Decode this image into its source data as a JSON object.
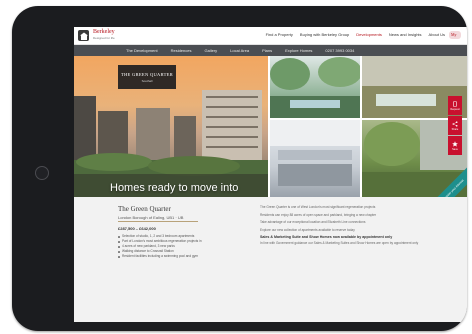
{
  "header": {
    "logo_text": "Berkeley",
    "logo_sub": "Designed for life",
    "links": [
      "Find a Property",
      "Buying with Berkeley Group",
      "Developments",
      "News and Insights",
      "About Us"
    ],
    "active_link": "Developments",
    "my_account_label": "My"
  },
  "nav": {
    "items": [
      "The Development",
      "Residences",
      "Gallery",
      "Local Area",
      "Plans",
      "Explore Homes",
      "0207 3993 0034"
    ]
  },
  "hero": {
    "title_box": {
      "title": "THE GREEN QUARTER",
      "subtitle": "Southall"
    },
    "headline": "Homes ready to move into",
    "side_tabs": [
      "Request",
      "Share",
      "Save"
    ],
    "ribbon_text": "Register your interest"
  },
  "development": {
    "title": "The Green Quarter",
    "location": "London Borough of Ealing, UB1 · UB",
    "price": "£287,500 – £642,000",
    "bullets": [
      "Selection of studio, 1, 2 and 3 bedroom apartments",
      "Part of London's most ambitious regeneration projects in",
      "4 acres of new parkland, 3 new parks",
      "Walking distance to Crossrail Station",
      "Resident facilities including a swimming pool and gym"
    ]
  },
  "right_column": {
    "paragraphs": [
      "The Green Quarter is one of West London's most significant regeneration projects",
      "Residents can enjoy 88 acres of open space and parkland, bringing a new chapter",
      "Take advantage of our exceptional location and Elizabeth Line connections",
      "Explore our new collection of apartments available to reserve today"
    ],
    "sub_heading": "Sales & Marketing Suite and Show Homes now available by appointment only",
    "sub_paragraph": "In line with Government guidance our Sales & Marketing Suites and Show Homes are open by appointment only"
  },
  "colors": {
    "brand_red": "#b5121b",
    "side_tab_red": "#c8102e",
    "nav_grey": "#4b4e53",
    "ribbon_teal": "#1e8f8d",
    "tablet_frame": "#1b1c1f"
  },
  "icons": [
    "berkeley-logo-icon",
    "phone-icon",
    "share-icon",
    "star-icon",
    "home-button-icon"
  ]
}
